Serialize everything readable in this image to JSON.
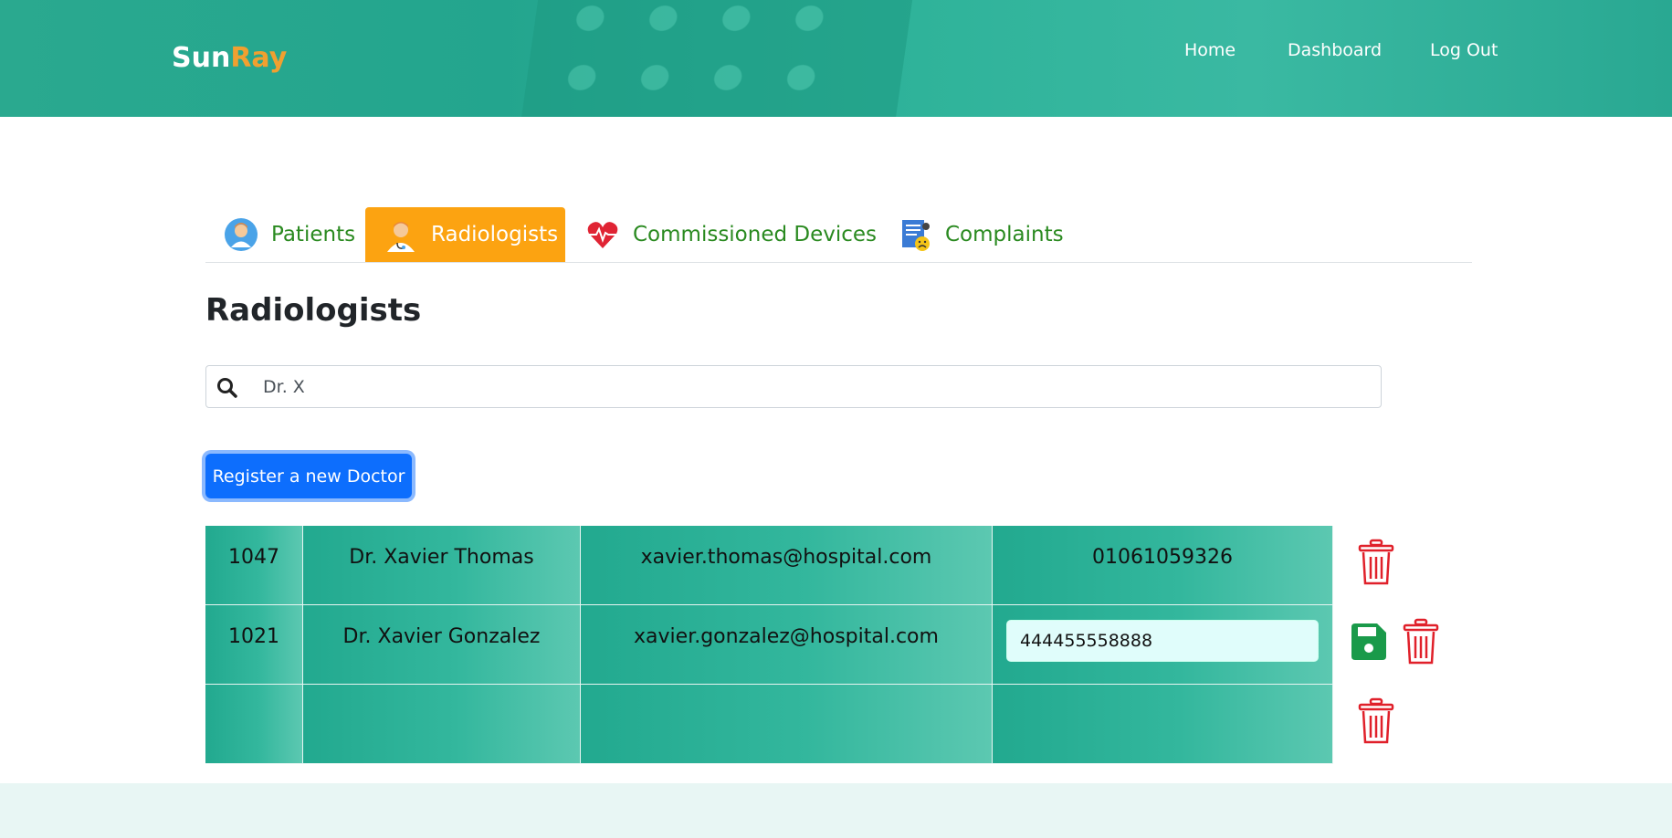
{
  "brand": {
    "part1": "Sun",
    "part2": "Ray"
  },
  "nav": {
    "home": "Home",
    "dashboard": "Dashboard",
    "logout": "Log Out"
  },
  "tabs": [
    {
      "label": "Patients",
      "icon": "patient-avatar-icon"
    },
    {
      "label": "Radiologists",
      "icon": "doctor-avatar-icon",
      "active": true
    },
    {
      "label": "Commissioned Devices",
      "icon": "heart-pulse-icon"
    },
    {
      "label": "Complaints",
      "icon": "complaint-document-icon"
    }
  ],
  "page": {
    "title": "Radiologists"
  },
  "search": {
    "value": "Dr. X",
    "icon": "search-icon"
  },
  "register_button": "Register a new Doctor",
  "table": {
    "rows": [
      {
        "id": "1047",
        "name": "Dr. Xavier Thomas",
        "email": "xavier.thomas@hospital.com",
        "phone": "01061059326",
        "editing": false
      },
      {
        "id": "1021",
        "name": "Dr. Xavier Gonzalez",
        "email": "xavier.gonzalez@hospital.com",
        "phone": "444455558888",
        "editing": true
      },
      {
        "id": "",
        "name": "",
        "email": "",
        "phone": "",
        "editing": false
      }
    ]
  },
  "colors": {
    "header_teal": "#2aa98f",
    "brand_accent": "#f0a030",
    "active_tab": "#fca311",
    "tab_text": "#2a8a20",
    "primary_button": "#0d6efd",
    "delete_red": "#e0202a",
    "save_green": "#1a9a4a"
  }
}
